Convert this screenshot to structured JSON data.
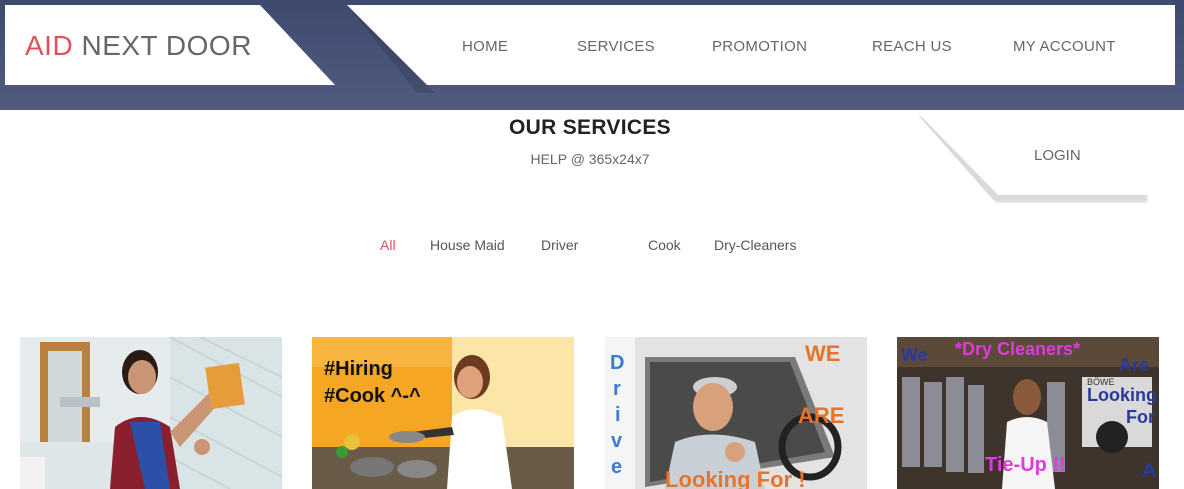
{
  "brand": {
    "accent": "AID",
    "rest": " NEXT DOOR",
    "accent_color": "#e0505a"
  },
  "nav": {
    "items": [
      "HOME",
      "SERVICES",
      "PROMOTION",
      "REACH US",
      "MY ACCOUNT"
    ]
  },
  "section": {
    "title": "OUR SERVICES",
    "subtitle": "HELP @ 365x24x7"
  },
  "login": {
    "label": "LOGIN"
  },
  "filters": {
    "items": [
      "All",
      "House Maid",
      "Driver",
      "Cook",
      "Dry-Cleaners"
    ],
    "active": "All"
  },
  "cards": [
    {
      "name": "House Maid"
    },
    {
      "name": "Cook",
      "line1": "#Hiring",
      "line2": "#Cook ^-^"
    },
    {
      "name": "Driver",
      "word_we": "WE",
      "word_are": "ARE",
      "vertical": "Drive",
      "bottom": "Looking For !"
    },
    {
      "name": "Dry-Cleaners",
      "top_left": "We",
      "headline": "*Dry Cleaners*",
      "right1": "Are",
      "right2": "Looking",
      "right3": "For",
      "sign": "BÖWE",
      "tie": "Tie-Up !!",
      "corner": "A"
    }
  ]
}
